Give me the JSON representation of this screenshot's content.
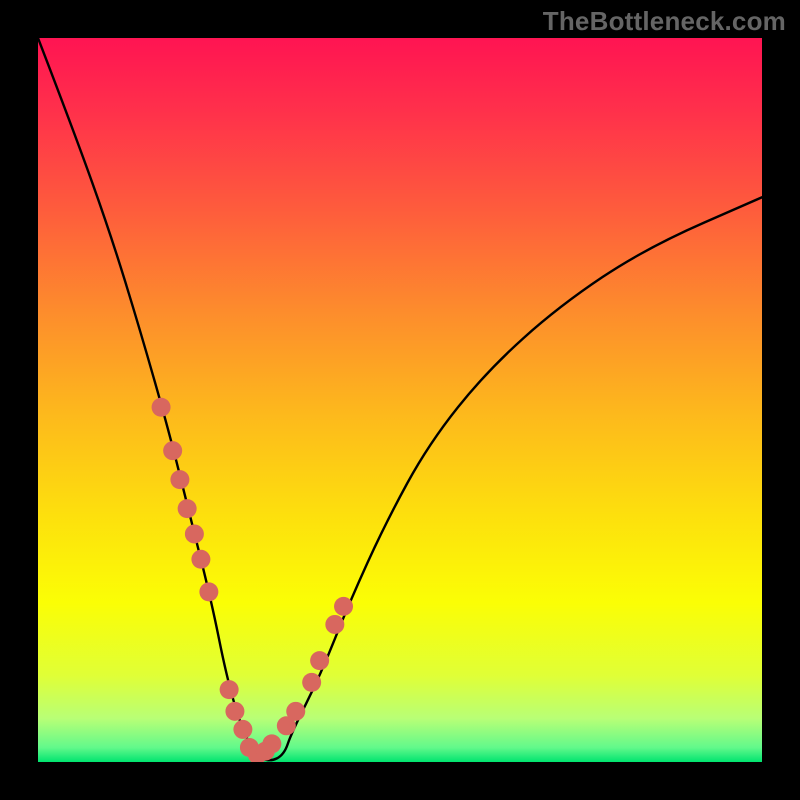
{
  "watermark": "TheBottleneck.com",
  "chart_data": {
    "type": "line",
    "title": "",
    "xlabel": "",
    "ylabel": "",
    "xlim": [
      0,
      100
    ],
    "ylim": [
      0,
      100
    ],
    "annotations": [],
    "series": [
      {
        "name": "bottleneck-curve",
        "x": [
          0,
          5,
          10,
          14,
          18,
          21,
          24,
          26,
          28,
          30,
          32,
          34,
          35,
          39,
          43,
          48,
          54,
          62,
          72,
          84,
          100
        ],
        "values": [
          100,
          87,
          73,
          60,
          46,
          34,
          22,
          12,
          5,
          1,
          0,
          1,
          4,
          12,
          22,
          33,
          44,
          54,
          63,
          71,
          78
        ]
      }
    ],
    "markers": {
      "name": "highlight-dots",
      "color": "#d8675f",
      "x": [
        17.0,
        18.6,
        19.6,
        20.6,
        21.6,
        22.5,
        23.6,
        26.4,
        27.2,
        28.3,
        29.2,
        30.3,
        31.4,
        32.3,
        34.3,
        35.6,
        37.8,
        38.9,
        41.0,
        42.2
      ],
      "values": [
        49.0,
        43.0,
        39.0,
        35.0,
        31.5,
        28.0,
        23.5,
        10.0,
        7.0,
        4.5,
        2.0,
        1.0,
        1.5,
        2.5,
        5.0,
        7.0,
        11.0,
        14.0,
        19.0,
        21.5
      ]
    },
    "background_gradient": {
      "orientation": "vertical",
      "stops": [
        {
          "pos": 0.0,
          "color": "#ff1452"
        },
        {
          "pos": 0.1,
          "color": "#ff304b"
        },
        {
          "pos": 0.24,
          "color": "#fe5d3c"
        },
        {
          "pos": 0.38,
          "color": "#fd8d2c"
        },
        {
          "pos": 0.52,
          "color": "#fdb91c"
        },
        {
          "pos": 0.66,
          "color": "#fde00d"
        },
        {
          "pos": 0.78,
          "color": "#fbfe05"
        },
        {
          "pos": 0.88,
          "color": "#e0ff36"
        },
        {
          "pos": 0.94,
          "color": "#b8ff76"
        },
        {
          "pos": 0.98,
          "color": "#62f98b"
        },
        {
          "pos": 1.0,
          "color": "#00e46f"
        }
      ]
    }
  }
}
